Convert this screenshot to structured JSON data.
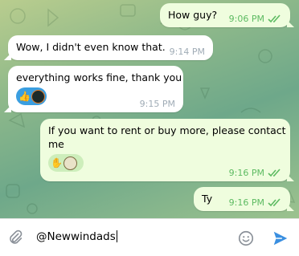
{
  "messages": [
    {
      "dir": "out",
      "text": "How guy?",
      "time": "9:06 PM",
      "read": true
    },
    {
      "dir": "in",
      "text": "Wow, I didn't even know that.",
      "time": "9:14 PM"
    },
    {
      "dir": "in",
      "text": "everything works fine, thank you",
      "time": "9:15 PM",
      "reaction": "thumbs-up-icon"
    },
    {
      "dir": "out",
      "text_line1": "If you want to rent or buy more, please contact",
      "text_line2": "me",
      "time": "9:16 PM",
      "read": true,
      "reaction": "hand-icon"
    },
    {
      "dir": "out",
      "text": "Ty",
      "time": "9:16 PM",
      "read": true
    }
  ],
  "composer": {
    "value": "@Newwindads",
    "icons": [
      "paperclip-icon",
      "emoji-icon",
      "send-icon"
    ]
  },
  "colors": {
    "incoming_bubble": "#ffffff",
    "outgoing_bubble": "#effdde",
    "check_green": "#5dbb62",
    "send_blue": "#3a8fe0"
  }
}
